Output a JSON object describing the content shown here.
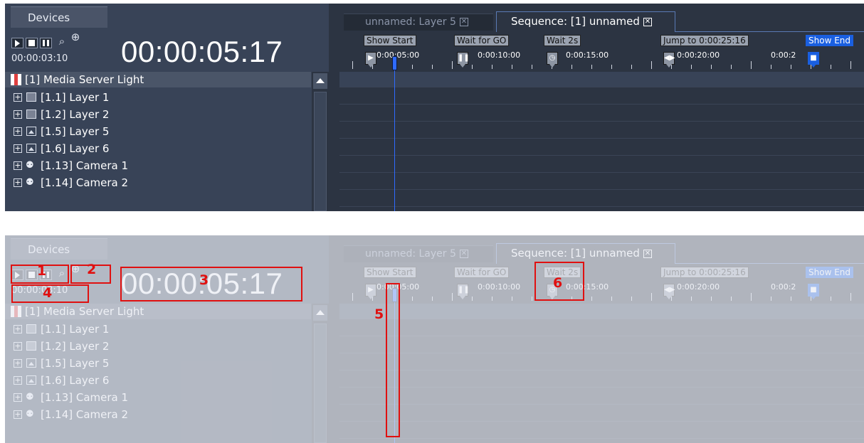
{
  "devices_tab": "Devices",
  "timecode_main": "00:00:05:17",
  "timecode_elapsed": "00:00:03:10",
  "media_server": "[1] Media Server Light",
  "layers": [
    {
      "label": "[1.1] Layer 1",
      "icon": "layer-icon"
    },
    {
      "label": "[1.2] Layer 2",
      "icon": "layer-icon"
    },
    {
      "label": "[1.5] Layer 5",
      "icon": "image-layer-icon"
    },
    {
      "label": "[1.6] Layer 6",
      "icon": "image-layer-icon"
    },
    {
      "label": "[1.13] Camera 1",
      "icon": "camera-icon"
    },
    {
      "label": "[1.14] Camera 2",
      "icon": "camera-icon"
    }
  ],
  "tab_layer": "unnamed: Layer 5",
  "tab_sequence": "Sequence: [1] unnamed",
  "cues": [
    "Show Start",
    "Wait for GO",
    "Wait 2s",
    "Jump to 0:00:25:16",
    "Show End"
  ],
  "ticks": [
    "0:00:05:00",
    "0:00:10:00",
    "0:00:15:00",
    "0:00:20:00",
    "0:00:2"
  ],
  "annotation_numbers": [
    "1",
    "2",
    "3",
    "4",
    "5",
    "6"
  ],
  "colors": {
    "annotation": "#e01010",
    "playhead": "#2f6bff",
    "show_end": "#1a5fe0"
  }
}
